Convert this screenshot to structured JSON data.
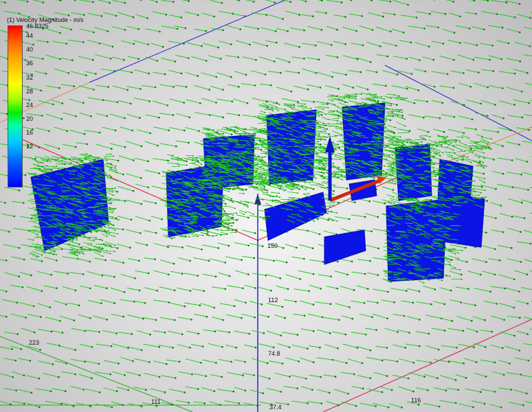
{
  "legend": {
    "title": "(1) Velocity Magnitude - m/s",
    "max": "46.8325",
    "ticks": [
      "44",
      "40",
      "36",
      "32",
      "28",
      "24",
      "20",
      "16",
      "12"
    ]
  },
  "axes": {
    "x_labels": [
      "150",
      "112",
      "74.8",
      "37.4"
    ],
    "left_label": "223",
    "bottom_left": "111",
    "bottom_right": "116"
  },
  "colors": {
    "building": "#0b14e6",
    "vector": "#22c81e",
    "vector_head": "#0f7a0f",
    "axis_blue": "#2222cc",
    "axis_red": "#d4183a",
    "axis_green": "#22aa22",
    "axis_orange": "#e08a3c"
  },
  "icons": [
    "velocity-arrow-icon",
    "origin-axis-arrow-icon"
  ]
}
